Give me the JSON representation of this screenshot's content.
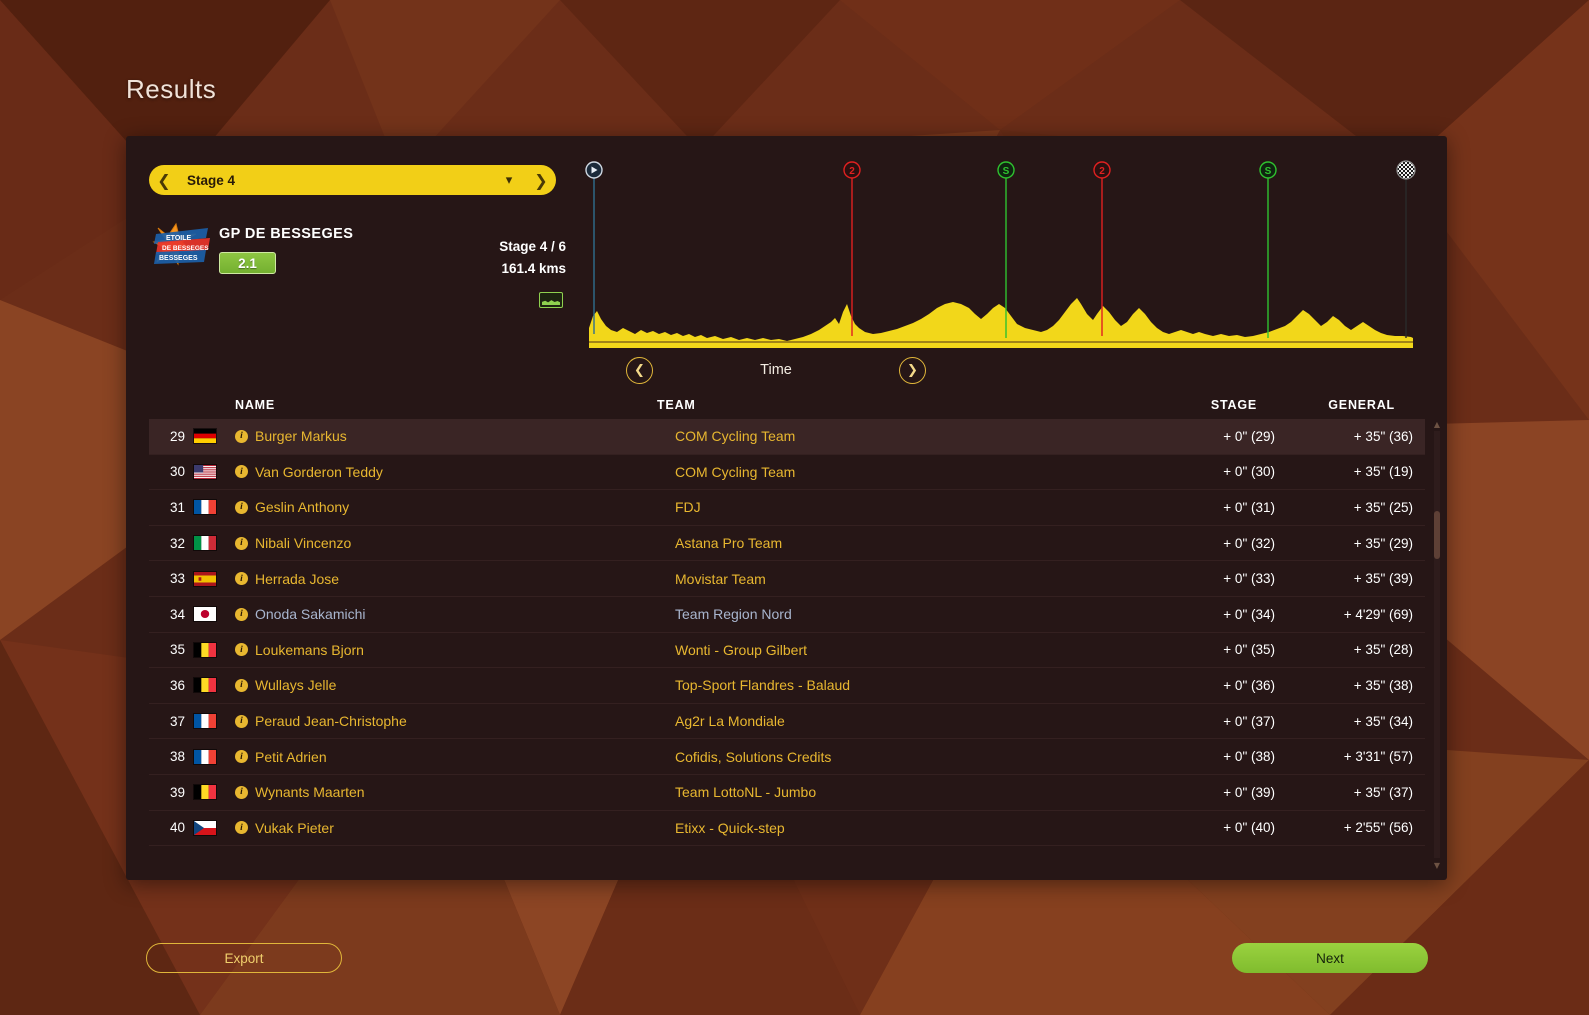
{
  "page": {
    "title": "Results"
  },
  "stage_selector": {
    "prev_icon": "chevron-left-icon",
    "label": "Stage 4",
    "dropdown_icon": "chevron-down-icon",
    "next_icon": "chevron-right-icon"
  },
  "race": {
    "name": "GP DE BESSEGES",
    "category": "2.1",
    "stage_count": "Stage 4 / 6",
    "distance": "161.4 kms",
    "profile_type_icon": "flat-stage-icon",
    "logo_text_top": "ETOILE",
    "logo_text_mid": "DE BESSEGES",
    "logo_text_bottom": "BESSEGES"
  },
  "time_nav": {
    "prev_icon": "chevron-left-circle-icon",
    "label": "Time",
    "next_icon": "chevron-right-circle-icon"
  },
  "profile": {
    "markers": [
      {
        "type": "start",
        "glyph": "▶",
        "x_pct": 0.6,
        "color": "#2f6f8f",
        "label": "start-marker"
      },
      {
        "type": "climb",
        "glyph": "2",
        "x_pct": 32.0,
        "color": "#e02020",
        "label": "climb-cat2-marker"
      },
      {
        "type": "sprint",
        "glyph": "S",
        "x_pct": 50.6,
        "color": "#2fc22f",
        "label": "sprint-marker"
      },
      {
        "type": "climb",
        "glyph": "2",
        "x_pct": 62.2,
        "color": "#e02020",
        "label": "climb-cat2-marker"
      },
      {
        "type": "sprint",
        "glyph": "S",
        "x_pct": 82.0,
        "color": "#2fc22f",
        "label": "sprint-marker"
      },
      {
        "type": "finish",
        "glyph": "",
        "x_pct": 99.2,
        "color": "#cccccc",
        "label": "finish-marker"
      }
    ],
    "fill_color": "#f2d71a"
  },
  "table": {
    "headers": {
      "rank": "",
      "flag": "",
      "name": "NAME",
      "team": "TEAM",
      "stage": "STAGE",
      "general": "GENERAL"
    },
    "rows": [
      {
        "rank": "29",
        "country": "de",
        "name": "Burger Markus",
        "team": "COM Cycling Team",
        "stage": "+ 0\" (29)",
        "general": "+ 35\" (36)",
        "highlight": true,
        "player": false
      },
      {
        "rank": "30",
        "country": "us",
        "name": "Van Gorderon Teddy",
        "team": "COM Cycling Team",
        "stage": "+ 0\" (30)",
        "general": "+ 35\" (19)",
        "highlight": false,
        "player": false
      },
      {
        "rank": "31",
        "country": "fr",
        "name": "Geslin Anthony",
        "team": "FDJ",
        "stage": "+ 0\" (31)",
        "general": "+ 35\" (25)",
        "highlight": false,
        "player": false
      },
      {
        "rank": "32",
        "country": "it",
        "name": "Nibali Vincenzo",
        "team": "Astana Pro Team",
        "stage": "+ 0\" (32)",
        "general": "+ 35\" (29)",
        "highlight": false,
        "player": false
      },
      {
        "rank": "33",
        "country": "es",
        "name": "Herrada Jose",
        "team": "Movistar Team",
        "stage": "+ 0\" (33)",
        "general": "+ 35\" (39)",
        "highlight": false,
        "player": false
      },
      {
        "rank": "34",
        "country": "jp",
        "name": "Onoda Sakamichi",
        "team": "Team Region Nord",
        "stage": "+ 0\" (34)",
        "general": "+ 4'29\" (69)",
        "highlight": false,
        "player": true
      },
      {
        "rank": "35",
        "country": "be",
        "name": "Loukemans Bjorn",
        "team": "Wonti - Group Gilbert",
        "stage": "+ 0\" (35)",
        "general": "+ 35\" (28)",
        "highlight": false,
        "player": false
      },
      {
        "rank": "36",
        "country": "be",
        "name": "Wullays Jelle",
        "team": "Top-Sport Flandres - Balaud",
        "stage": "+ 0\" (36)",
        "general": "+ 35\" (38)",
        "highlight": false,
        "player": false
      },
      {
        "rank": "37",
        "country": "fr",
        "name": "Peraud Jean-Christophe",
        "team": "Ag2r La Mondiale",
        "stage": "+ 0\" (37)",
        "general": "+ 35\" (34)",
        "highlight": false,
        "player": false
      },
      {
        "rank": "38",
        "country": "fr",
        "name": "Petit Adrien",
        "team": "Cofidis, Solutions Credits",
        "stage": "+ 0\" (38)",
        "general": "+ 3'31\" (57)",
        "highlight": false,
        "player": false
      },
      {
        "rank": "39",
        "country": "be",
        "name": "Wynants Maarten",
        "team": "Team LottoNL - Jumbo",
        "stage": "+ 0\" (39)",
        "general": "+ 35\" (37)",
        "highlight": false,
        "player": false
      },
      {
        "rank": "40",
        "country": "cz",
        "name": "Vukak Pieter",
        "team": "Etixx - Quick-step",
        "stage": "+ 0\" (40)",
        "general": "+ 2'55\" (56)",
        "highlight": false,
        "player": false
      }
    ]
  },
  "scrollbar": {
    "up_icon": "triangle-up-icon",
    "down_icon": "triangle-down-icon"
  },
  "footer": {
    "export_label": "Export",
    "next_label": "Next"
  },
  "colors": {
    "accent_yellow": "#f2cf17",
    "row_text": "#e8b730",
    "player_text": "#a9b6cf",
    "green_button": "#8fc93f",
    "panel_bg": "#261616",
    "page_bg": "#6b2d18"
  }
}
